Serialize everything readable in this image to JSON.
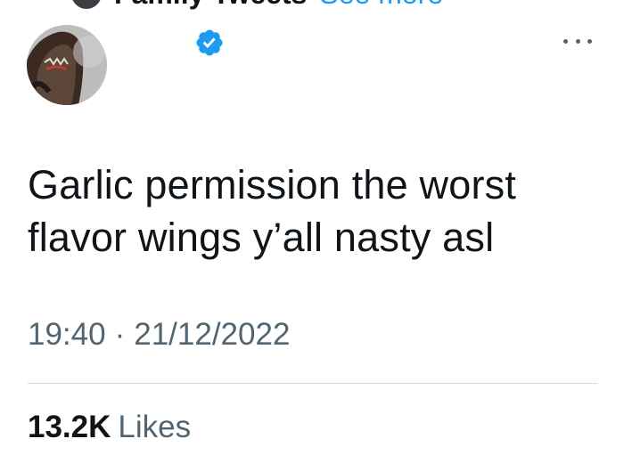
{
  "context": {
    "name": "Family Tweets",
    "link": "See more"
  },
  "tweet": {
    "text_line1": "Garlic permission the worst",
    "text_line2": "flavor wings y’all nasty asl",
    "time": "19:40",
    "separator": "·",
    "date": "21/12/2022"
  },
  "stats": {
    "likes_count": "13.2K",
    "likes_label": "Likes"
  },
  "icons": {
    "verified": "verified-badge-icon",
    "more": "more-horizontal-icon"
  },
  "colors": {
    "text": "#0f1419",
    "secondary": "#536471",
    "accent": "#1d9bf0",
    "divider": "#cfd9de"
  }
}
